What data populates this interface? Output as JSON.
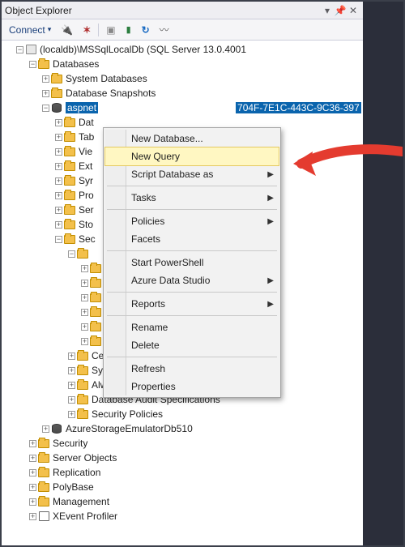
{
  "titlebar": {
    "title": "Object Explorer"
  },
  "toolbar": {
    "connect_label": "Connect",
    "disconnect_tip": "Disconnect",
    "newquery_tip": "New Query",
    "filter_tip": "Filter",
    "stop_tip": "Stop",
    "refresh_tip": "Refresh",
    "activity_tip": "Activity Monitor"
  },
  "tree": {
    "server": "(localdb)\\MSSqlLocalDb (SQL Server 13.0.4001",
    "databases": "Databases",
    "system_databases": "System Databases",
    "database_snapshots": "Database Snapshots",
    "selected_db_prefix": "aspnet",
    "selected_db_suffix": "704F-7E1C-443C-9C36-397",
    "children_short": [
      "Dat",
      "Tab",
      "Vie",
      "Ext",
      "Syr",
      "Pro",
      "Ser",
      "Sto"
    ],
    "security_short": "Sec",
    "sec_sub": [
      "",
      "",
      "",
      "",
      "",
      ""
    ],
    "security_full": [
      "Certificates",
      "Symmetric Keys",
      "Always Encrypted Keys",
      "Database Audit Specifications",
      "Security Policies"
    ],
    "azure_db": "AzureStorageEmulatorDb510",
    "top_folders": [
      "Security",
      "Server Objects",
      "Replication",
      "PolyBase",
      "Management"
    ],
    "xevent": "XEvent Profiler"
  },
  "context_menu": {
    "items": [
      {
        "label": "New Database...",
        "sub": false
      },
      {
        "label": "New Query",
        "sub": false,
        "highlight": true
      },
      {
        "label": "Script Database as",
        "sub": true
      },
      {
        "sep": true
      },
      {
        "label": "Tasks",
        "sub": true
      },
      {
        "sep": true
      },
      {
        "label": "Policies",
        "sub": true
      },
      {
        "label": "Facets",
        "sub": false
      },
      {
        "sep": true
      },
      {
        "label": "Start PowerShell",
        "sub": false
      },
      {
        "label": "Azure Data Studio",
        "sub": true
      },
      {
        "sep": true
      },
      {
        "label": "Reports",
        "sub": true
      },
      {
        "sep": true
      },
      {
        "label": "Rename",
        "sub": false
      },
      {
        "label": "Delete",
        "sub": false
      },
      {
        "sep": true
      },
      {
        "label": "Refresh",
        "sub": false
      },
      {
        "label": "Properties",
        "sub": false
      }
    ]
  }
}
